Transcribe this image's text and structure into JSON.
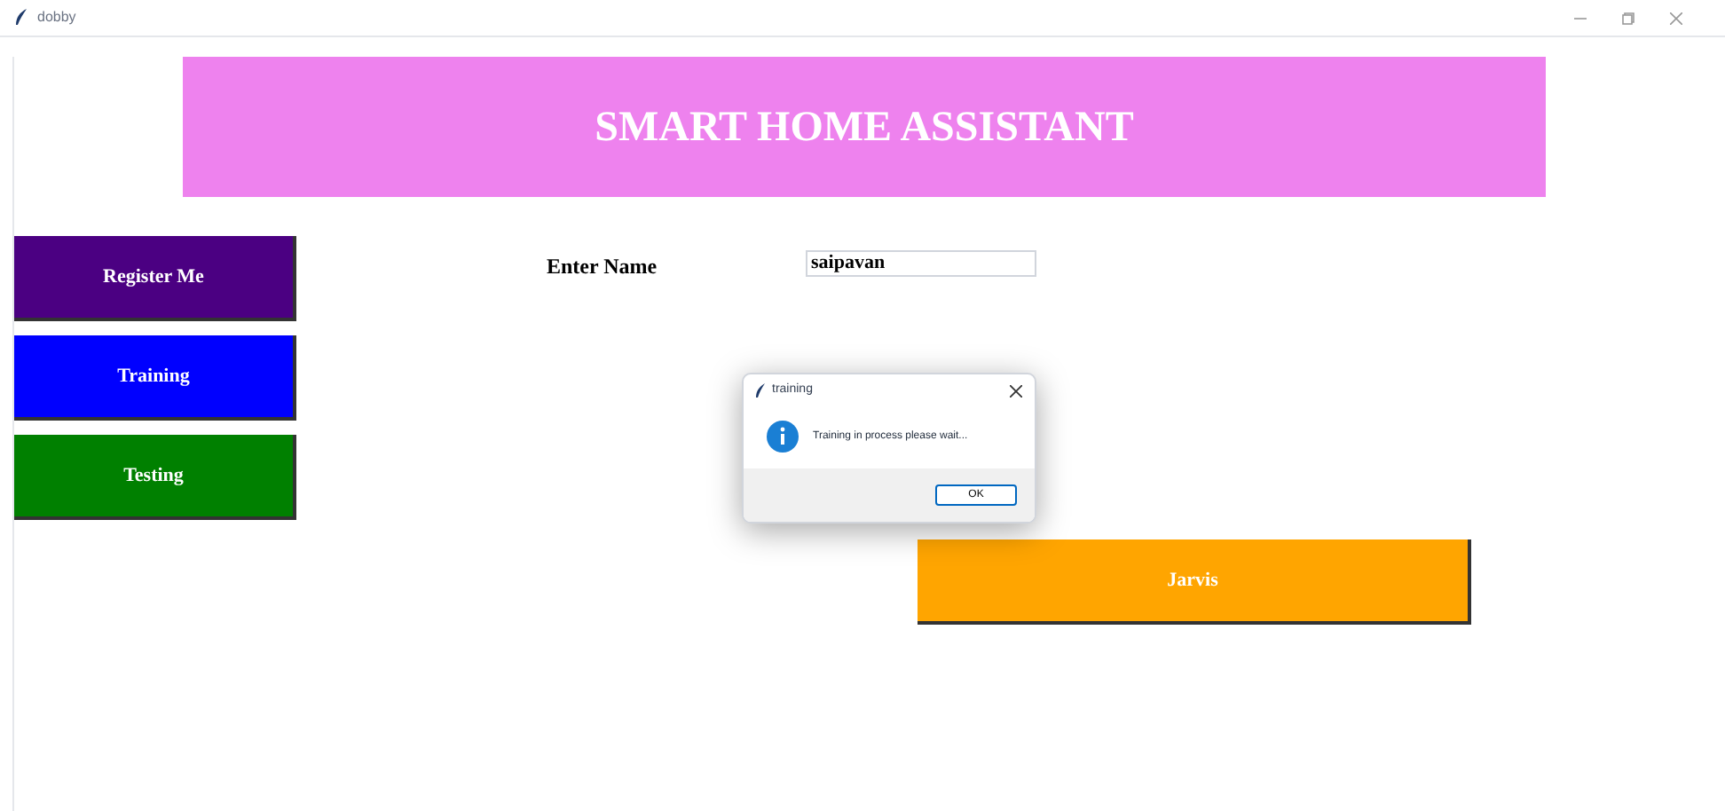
{
  "window": {
    "title": "dobby"
  },
  "header": {
    "title": "SMART HOME ASSISTANT"
  },
  "buttons": [
    {
      "label": "Register Me",
      "color": "#4b0082"
    },
    {
      "label": "Training",
      "color": "#0000ff"
    },
    {
      "label": "Testing",
      "color": "#008000"
    }
  ],
  "name_field": {
    "label": "Enter Name",
    "value": "saipavan"
  },
  "jarvis_button": {
    "label": "Jarvis"
  },
  "dialog": {
    "title": "training",
    "message": "Training in process please wait...",
    "ok": "OK"
  }
}
